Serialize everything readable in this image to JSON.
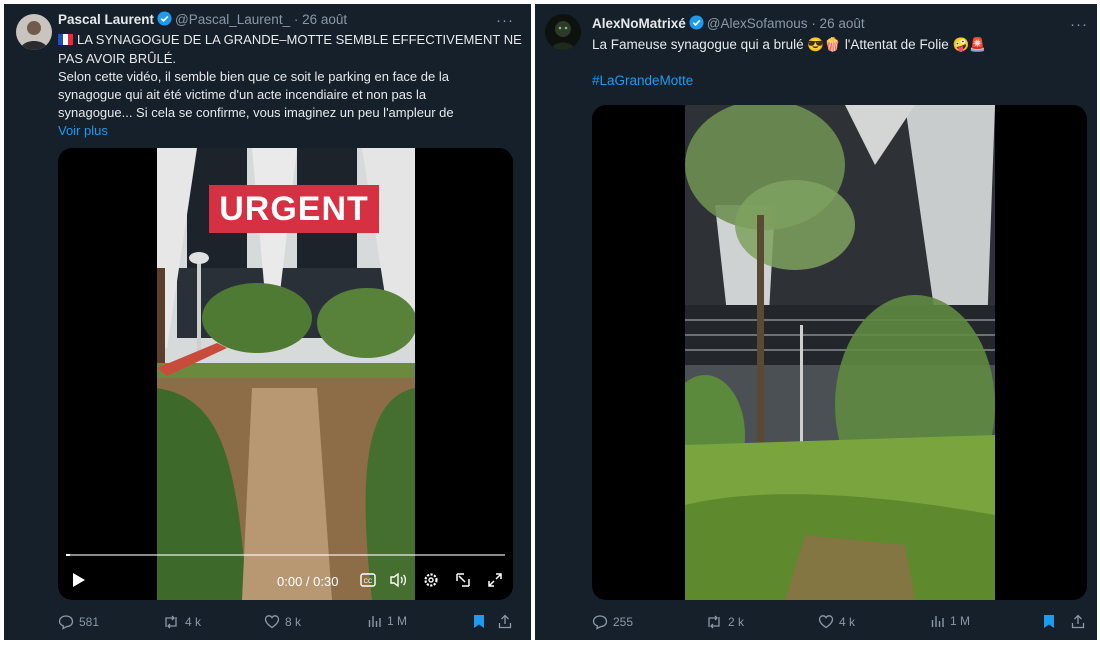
{
  "left_tweet": {
    "author_name": "Pascal Laurent",
    "handle": "@Pascal_Laurent_",
    "date": "· 26 août",
    "more": "···",
    "flag_icon": "french-flag",
    "text_lines": [
      "LA SYNAGOGUE DE LA GRANDE–MOTTE SEMBLE EFFECTIVEMENT NE",
      "PAS AVOIR BRÛLÉ.",
      "Selon cette vidéo, il semble bien que ce soit le parking en face de la",
      "synagogue qui ait été victime d'un acte incendiaire et non pas la",
      "synagogue... Si cela se confirme, vous imaginez un peu l'ampleur de"
    ],
    "show_more": "Voir plus",
    "video": {
      "overlay_text": "URGENT",
      "time": "0:00 / 0:30",
      "progress": 0.01
    },
    "actions": {
      "replies": "581",
      "reposts": "4 k",
      "likes": "8 k",
      "views": "1 M"
    }
  },
  "right_tweet": {
    "author_name": "AlexNoMatrixé",
    "handle": "@AlexSofamous",
    "date": "· 26 août",
    "more": "···",
    "text": "La Fameuse synagogue qui a brulé",
    "emoji_1": "😎🍿",
    "text_2": "l'Attentat de Folie",
    "emoji_2": "🤪🚨",
    "hashtag": "#LaGrandeMotte",
    "actions": {
      "replies": "255",
      "reposts": "2 k",
      "likes": "4 k",
      "views": "1 M"
    }
  },
  "colors": {
    "background": "#15202b",
    "accent": "#1d9bf0",
    "muted": "#8b98a5",
    "urgent_red": "#d63043"
  }
}
